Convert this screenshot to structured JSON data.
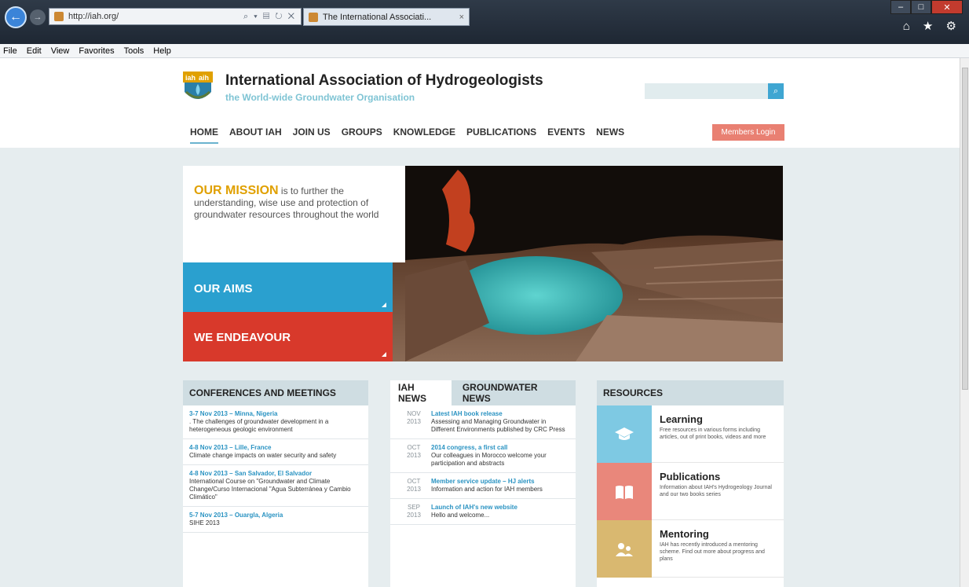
{
  "browser": {
    "url": "http://iah.org/",
    "tab_title": "The International Associati...",
    "tab_close": "×",
    "addr_tools": "⌕ ▾ ▤ ↻ ✕",
    "menu": [
      "File",
      "Edit",
      "View",
      "Favorites",
      "Tools",
      "Help"
    ],
    "toolbar_icons": "⌂ ★ ⚙",
    "win_min": "–",
    "win_max": "□",
    "win_close": "✕"
  },
  "site": {
    "logo_text": "iah aih",
    "name": "International Association of Hydrogeologists",
    "tagline": "the World-wide Groundwater Organisation",
    "search_icon": "⌕",
    "nav": [
      "HOME",
      "ABOUT IAH",
      "JOIN US",
      "GROUPS",
      "KNOWLEDGE",
      "PUBLICATIONS",
      "EVENTS",
      "NEWS"
    ],
    "login": "Members Login"
  },
  "hero": {
    "mission_big": "OUR MISSION",
    "mission_text": " is to further the understanding, wise use and protection of groundwater resources throughout the world",
    "aims": "OUR AIMS",
    "endeavour": "WE ENDEAVOUR"
  },
  "conferences": {
    "title": "CONFERENCES AND MEETINGS",
    "items": [
      {
        "title": "3-7 Nov 2013 – Minna, Nigeria",
        "desc": ". The challenges of groundwater development in a heterogeneous geologic environment"
      },
      {
        "title": "4-8 Nov 2013 – Lille, France",
        "desc": "Climate change impacts on water security and safety"
      },
      {
        "title": "4-8 Nov 2013 – San Salvador, El Salvador",
        "desc": "International Course on \"Groundwater and Climate Change/Curso Internacional \"Agua Subterránea y Cambio Climático\""
      },
      {
        "title": "5-7 Nov 2013 – Ouargla, Algeria",
        "desc": "SIHE 2013"
      }
    ]
  },
  "news": {
    "tab1": "IAH NEWS",
    "tab2": "GROUNDWATER NEWS",
    "items": [
      {
        "month": "NOV",
        "year": "2013",
        "title": "Latest IAH book release",
        "desc": "Assessing and Managing Groundwater in Different Environments published by CRC Press"
      },
      {
        "month": "OCT",
        "year": "2013",
        "title": "2014 congress, a first call",
        "desc": "Our colleagues in Morocco welcome your participation and abstracts"
      },
      {
        "month": "OCT",
        "year": "2013",
        "title": "Member service update – HJ alerts",
        "desc": "Information and action for IAH members"
      },
      {
        "month": "SEP",
        "year": "2013",
        "title": "Launch of IAH's new website",
        "desc": "Hello and welcome..."
      }
    ]
  },
  "resources": {
    "title": "RESOURCES",
    "items": [
      {
        "title": "Learning",
        "desc": "Free resources in various forms including articles, out of print books, videos and more",
        "color": "#7ec9e3",
        "icon": "graduation-cap-icon"
      },
      {
        "title": "Publications",
        "desc": "Information about IAH's Hydrogeology Journal and our two books series",
        "color": "#e9877b",
        "icon": "book-icon"
      },
      {
        "title": "Mentoring",
        "desc": "IAH has recently introduced a mentoring scheme. Find out more about progress and plans",
        "color": "#d9b870",
        "icon": "people-icon"
      }
    ]
  },
  "colors": {
    "accent": "#2aa0cf",
    "red": "#d8392b",
    "login": "#e98072",
    "gold": "#e0a000"
  }
}
